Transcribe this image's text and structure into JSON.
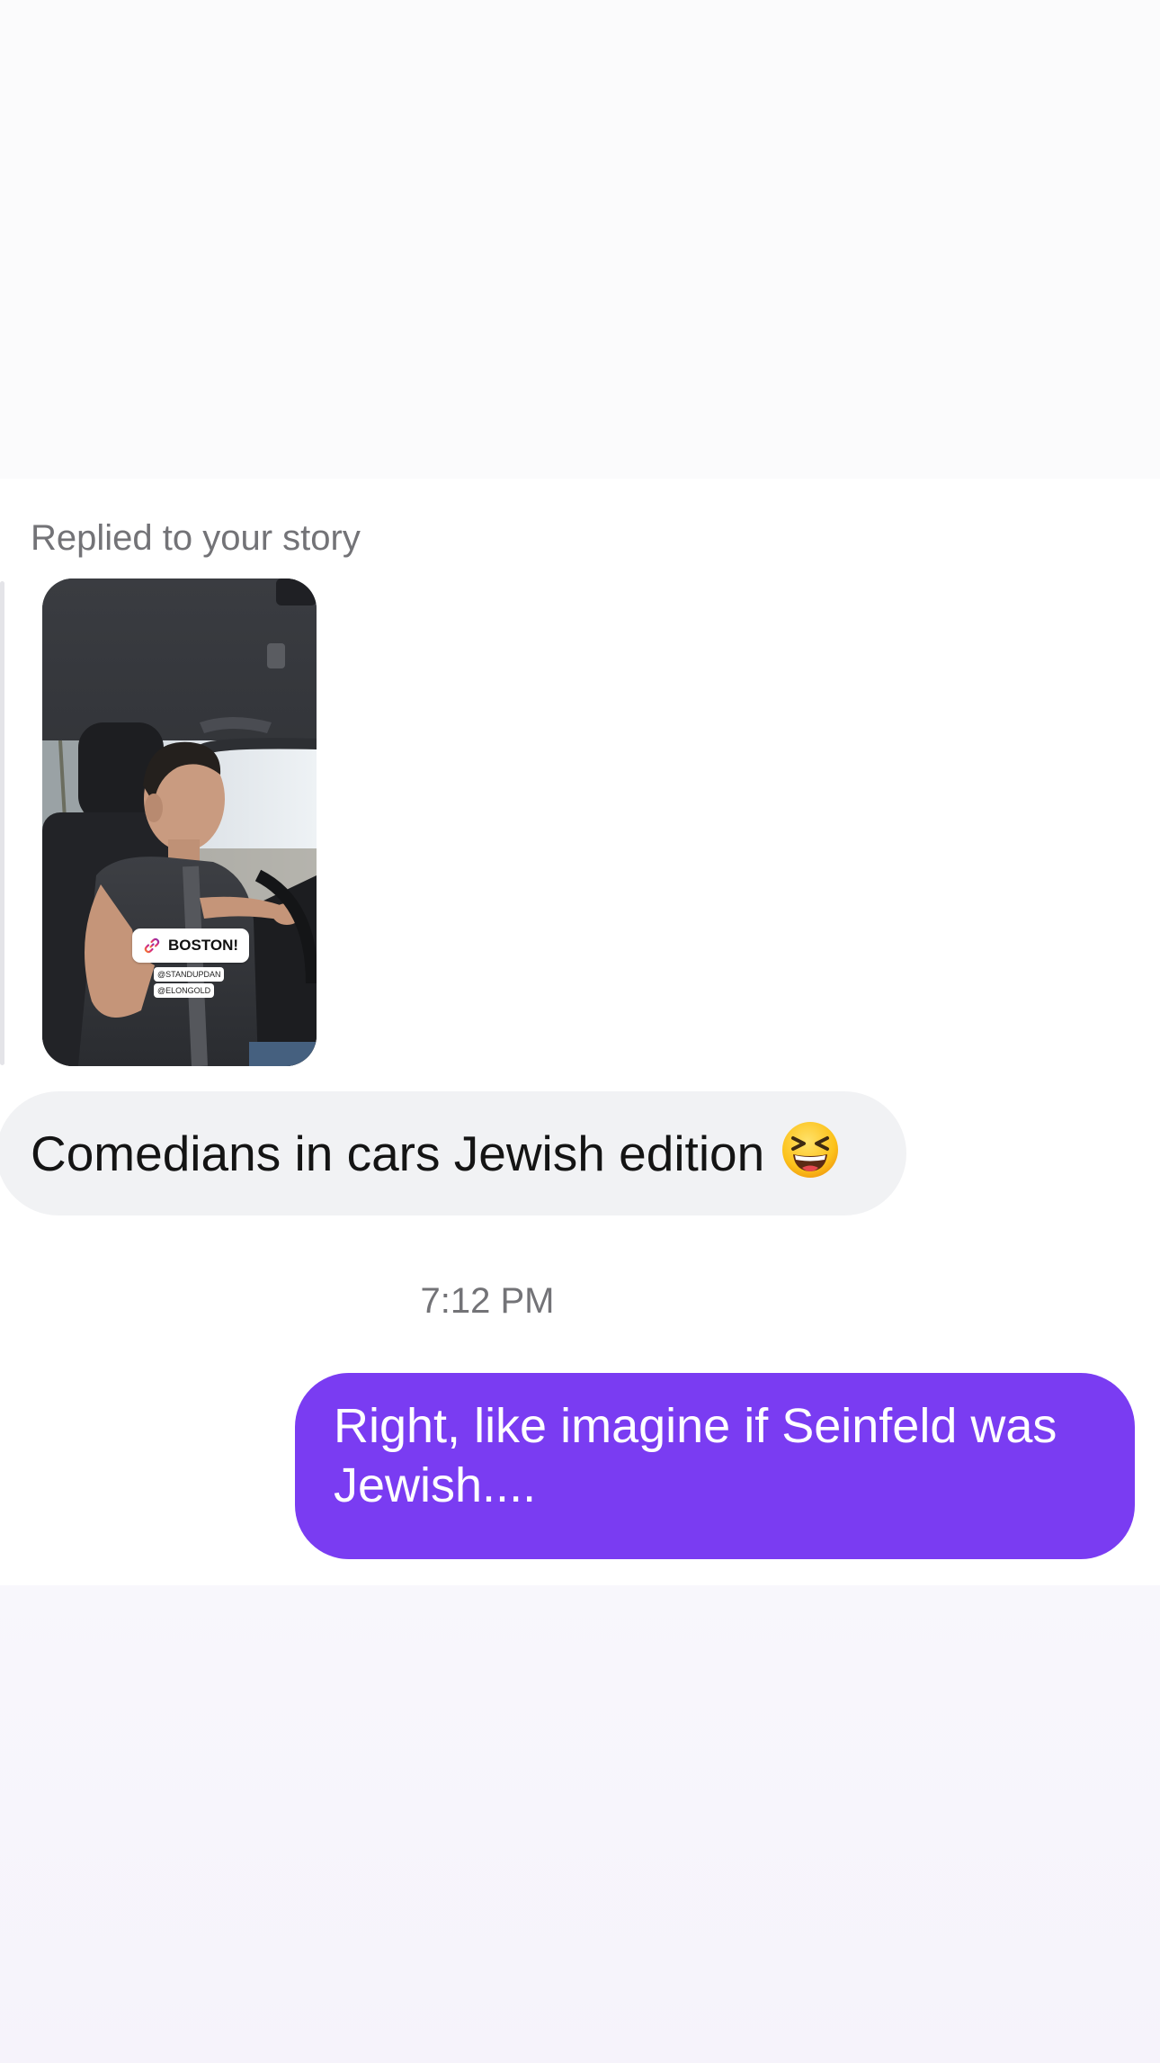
{
  "thread": {
    "reply_context_label": "Replied to your story",
    "story": {
      "sticker_link_text": "BOSTON!",
      "sticker_mention_1": "@STANDUPDAN",
      "sticker_mention_2": "@ELONGOLD"
    },
    "messages": [
      {
        "direction": "incoming",
        "text": "Comedians in cars Jewish edition",
        "emoji_icon": "grinning-squinting-face-emoji"
      },
      {
        "direction": "outgoing",
        "text": "Right, like imagine if Seinfeld was Jewish...."
      }
    ],
    "timestamp": "7:12 PM"
  },
  "colors": {
    "outgoing_bubble": "#7a3cf2",
    "incoming_bubble": "#f1f2f4",
    "secondary_text": "#737377"
  }
}
